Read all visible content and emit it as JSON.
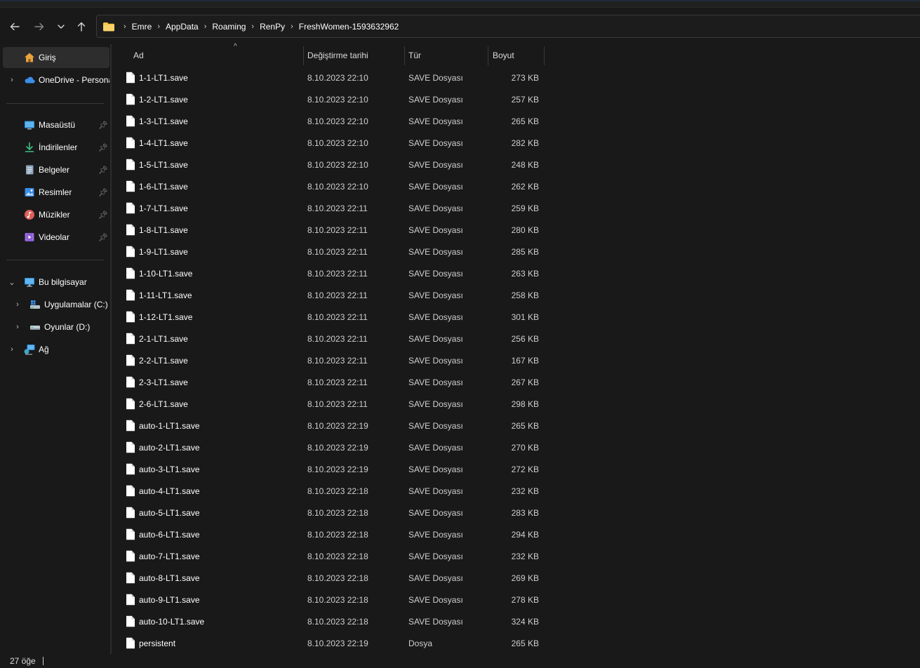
{
  "address": {
    "crumbs": [
      "Emre",
      "AppData",
      "Roaming",
      "RenPy",
      "FreshWomen-1593632962"
    ]
  },
  "sidebar": {
    "top": [
      {
        "label": "Giriş",
        "icon": "home-icon",
        "selected": true
      },
      {
        "label": "OneDrive - Personal",
        "icon": "onedrive-icon",
        "expandable": true
      }
    ],
    "quick": [
      {
        "label": "Masaüstü",
        "icon": "desktop-icon"
      },
      {
        "label": "İndirilenler",
        "icon": "downloads-icon"
      },
      {
        "label": "Belgeler",
        "icon": "documents-icon"
      },
      {
        "label": "Resimler",
        "icon": "pictures-icon"
      },
      {
        "label": "Müzikler",
        "icon": "music-icon"
      },
      {
        "label": "Videolar",
        "icon": "videos-icon"
      }
    ],
    "this_pc": {
      "label": "Bu bilgisayar",
      "icon": "computer-icon"
    },
    "drives": [
      {
        "label": "Uygulamalar (C:)",
        "icon": "drive-c-icon"
      },
      {
        "label": "Oyunlar (D:)",
        "icon": "drive-d-icon"
      }
    ],
    "network": {
      "label": "Ağ",
      "icon": "network-icon"
    }
  },
  "columns": {
    "name": "Ad",
    "date": "Değiştirme tarihi",
    "type": "Tür",
    "size": "Boyut"
  },
  "files": [
    {
      "name": "1-1-LT1.save",
      "date": "8.10.2023 22:10",
      "type": "SAVE Dosyası",
      "size": "273 KB"
    },
    {
      "name": "1-2-LT1.save",
      "date": "8.10.2023 22:10",
      "type": "SAVE Dosyası",
      "size": "257 KB"
    },
    {
      "name": "1-3-LT1.save",
      "date": "8.10.2023 22:10",
      "type": "SAVE Dosyası",
      "size": "265 KB"
    },
    {
      "name": "1-4-LT1.save",
      "date": "8.10.2023 22:10",
      "type": "SAVE Dosyası",
      "size": "282 KB"
    },
    {
      "name": "1-5-LT1.save",
      "date": "8.10.2023 22:10",
      "type": "SAVE Dosyası",
      "size": "248 KB"
    },
    {
      "name": "1-6-LT1.save",
      "date": "8.10.2023 22:10",
      "type": "SAVE Dosyası",
      "size": "262 KB"
    },
    {
      "name": "1-7-LT1.save",
      "date": "8.10.2023 22:11",
      "type": "SAVE Dosyası",
      "size": "259 KB"
    },
    {
      "name": "1-8-LT1.save",
      "date": "8.10.2023 22:11",
      "type": "SAVE Dosyası",
      "size": "280 KB"
    },
    {
      "name": "1-9-LT1.save",
      "date": "8.10.2023 22:11",
      "type": "SAVE Dosyası",
      "size": "285 KB"
    },
    {
      "name": "1-10-LT1.save",
      "date": "8.10.2023 22:11",
      "type": "SAVE Dosyası",
      "size": "263 KB"
    },
    {
      "name": "1-11-LT1.save",
      "date": "8.10.2023 22:11",
      "type": "SAVE Dosyası",
      "size": "258 KB"
    },
    {
      "name": "1-12-LT1.save",
      "date": "8.10.2023 22:11",
      "type": "SAVE Dosyası",
      "size": "301 KB"
    },
    {
      "name": "2-1-LT1.save",
      "date": "8.10.2023 22:11",
      "type": "SAVE Dosyası",
      "size": "256 KB"
    },
    {
      "name": "2-2-LT1.save",
      "date": "8.10.2023 22:11",
      "type": "SAVE Dosyası",
      "size": "167 KB"
    },
    {
      "name": "2-3-LT1.save",
      "date": "8.10.2023 22:11",
      "type": "SAVE Dosyası",
      "size": "267 KB"
    },
    {
      "name": "2-6-LT1.save",
      "date": "8.10.2023 22:11",
      "type": "SAVE Dosyası",
      "size": "298 KB"
    },
    {
      "name": "auto-1-LT1.save",
      "date": "8.10.2023 22:19",
      "type": "SAVE Dosyası",
      "size": "265 KB"
    },
    {
      "name": "auto-2-LT1.save",
      "date": "8.10.2023 22:19",
      "type": "SAVE Dosyası",
      "size": "270 KB"
    },
    {
      "name": "auto-3-LT1.save",
      "date": "8.10.2023 22:19",
      "type": "SAVE Dosyası",
      "size": "272 KB"
    },
    {
      "name": "auto-4-LT1.save",
      "date": "8.10.2023 22:18",
      "type": "SAVE Dosyası",
      "size": "232 KB"
    },
    {
      "name": "auto-5-LT1.save",
      "date": "8.10.2023 22:18",
      "type": "SAVE Dosyası",
      "size": "283 KB"
    },
    {
      "name": "auto-6-LT1.save",
      "date": "8.10.2023 22:18",
      "type": "SAVE Dosyası",
      "size": "294 KB"
    },
    {
      "name": "auto-7-LT1.save",
      "date": "8.10.2023 22:18",
      "type": "SAVE Dosyası",
      "size": "232 KB"
    },
    {
      "name": "auto-8-LT1.save",
      "date": "8.10.2023 22:18",
      "type": "SAVE Dosyası",
      "size": "269 KB"
    },
    {
      "name": "auto-9-LT1.save",
      "date": "8.10.2023 22:18",
      "type": "SAVE Dosyası",
      "size": "278 KB"
    },
    {
      "name": "auto-10-LT1.save",
      "date": "8.10.2023 22:18",
      "type": "SAVE Dosyası",
      "size": "324 KB"
    },
    {
      "name": "persistent",
      "date": "8.10.2023 22:19",
      "type": "Dosya",
      "size": "265 KB"
    }
  ],
  "status": {
    "item_count": "27 öğe"
  },
  "colors": {
    "background": "#191919",
    "selected": "#2d2d2d",
    "folder": "#f4c542",
    "accent": "#0078d4"
  }
}
